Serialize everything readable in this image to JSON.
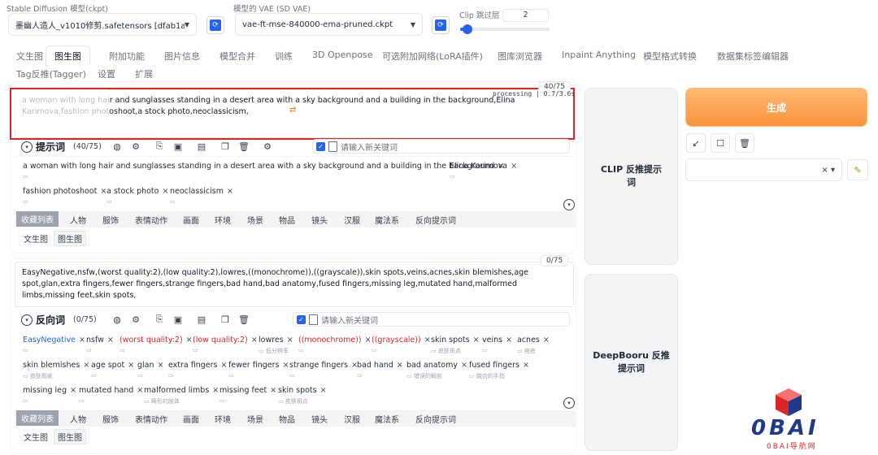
{
  "top": {
    "checkpoint_label": "Stable Diffusion 模型(ckpt)",
    "checkpoint_value": "墨幽人造人_v1010修剪.safetensors [dfab1a612",
    "vae_label": "模型的 VAE (SD VAE)",
    "vae_value": "vae-ft-mse-840000-ema-pruned.ckpt",
    "clip_label": "Clip 跳过层",
    "clip_value": "2",
    "clip_fraction": 0.08
  },
  "tabs": [
    "文生图",
    "图生图",
    "附加功能",
    "图片信息",
    "模型合并",
    "训练",
    "3D Openpose",
    "可选附加网络(LoRA插件)",
    "图库浏览器",
    "Inpaint Anything",
    "模型格式转换",
    "数据集标签编辑器",
    "Tag反推(Tagger)",
    "设置",
    "扩展"
  ],
  "active_tab": "图生图",
  "prompt": {
    "text": "a woman with long hair and sunglasses standing in a desert area with a sky background and a building in the background,Elina Karimova,fashion photoshoot,a stock photo,neoclassicism,",
    "counter": "40/75",
    "processing": "processing | 0.7/3.6s",
    "title": "提示词",
    "count": "(40/75)",
    "kw_placeholder": "请输入新关键词",
    "tags": [
      {
        "text": "a woman with long hair and sunglasses standing in a desert area with a sky background and a building in the background",
        "sub": ""
      },
      {
        "text": "Elina Karimova",
        "sub": ""
      },
      {
        "text": "fashion photoshoot",
        "sub": ""
      },
      {
        "text": "a stock photo",
        "sub": ""
      },
      {
        "text": "neoclassicism",
        "sub": ""
      }
    ]
  },
  "negative": {
    "text": "EasyNegative,nsfw,(worst quality:2),(low quality:2),lowres,((monochrome)),((grayscale)),skin spots,veins,acnes,skin blemishes,age spot,glan,extra fingers,fewer fingers,strange fingers,bad hand,bad anatomy,fused fingers,missing leg,mutated hand,malformed limbs,missing feet,skin spots,",
    "counter": "0/75",
    "title": "反向词",
    "count": "(0/75)",
    "kw_placeholder": "请输入新关键词",
    "tags": [
      {
        "text": "EasyNegative",
        "sub": "",
        "color": "blue"
      },
      {
        "text": "nsfw",
        "sub": "",
        "color": ""
      },
      {
        "text": "(worst quality:2)",
        "sub": "",
        "color": "red"
      },
      {
        "text": "(low quality:2)",
        "sub": "",
        "color": "red"
      },
      {
        "text": "lowres",
        "sub": "低分辨率",
        "color": ""
      },
      {
        "text": "((monochrome))",
        "sub": "",
        "color": "red"
      },
      {
        "text": "((grayscale))",
        "sub": "",
        "color": "red"
      },
      {
        "text": "skin spots",
        "sub": "皮肤斑点",
        "color": ""
      },
      {
        "text": "veins",
        "sub": "",
        "color": ""
      },
      {
        "text": "acnes",
        "sub": "痤疮",
        "color": ""
      },
      {
        "text": "skin blemishes",
        "sub": "皮肤瑕疵",
        "color": ""
      },
      {
        "text": "age spot",
        "sub": "",
        "color": ""
      },
      {
        "text": "glan",
        "sub": "",
        "color": ""
      },
      {
        "text": "extra fingers",
        "sub": "",
        "color": ""
      },
      {
        "text": "fewer fingers",
        "sub": "",
        "color": ""
      },
      {
        "text": "strange fingers",
        "sub": "",
        "color": ""
      },
      {
        "text": "bad hand",
        "sub": "",
        "color": ""
      },
      {
        "text": "bad anatomy",
        "sub": "错误的解剖",
        "color": ""
      },
      {
        "text": "fused fingers",
        "sub": "融合的手指",
        "color": ""
      },
      {
        "text": "missing leg",
        "sub": "",
        "color": ""
      },
      {
        "text": "mutated hand",
        "sub": "",
        "color": ""
      },
      {
        "text": "malformed limbs",
        "sub": "畸形的肢体",
        "color": ""
      },
      {
        "text": "missing feet",
        "sub": "",
        "color": ""
      },
      {
        "text": "skin spots",
        "sub": "皮肤斑点",
        "color": ""
      }
    ]
  },
  "categories": [
    "收藏列表",
    "人物",
    "服饰",
    "表情动作",
    "画面",
    "环境",
    "场景",
    "物品",
    "镜头",
    "汉服",
    "魔法系",
    "反向提示词"
  ],
  "subtabs": [
    "文生图",
    "图生图"
  ],
  "buttons": {
    "clip_interrogate": "CLIP      反推提示词",
    "deepbooru": "DeepBooru 反推提示词",
    "generate": "生成"
  },
  "style_select_value": "",
  "watermark": {
    "brand": "0BAI",
    "sub": "0BAI导航网"
  },
  "colors": {
    "accent_blue": "#2563eb",
    "generate_orange": "#fb923c",
    "highlight_red": "#dc2626"
  }
}
